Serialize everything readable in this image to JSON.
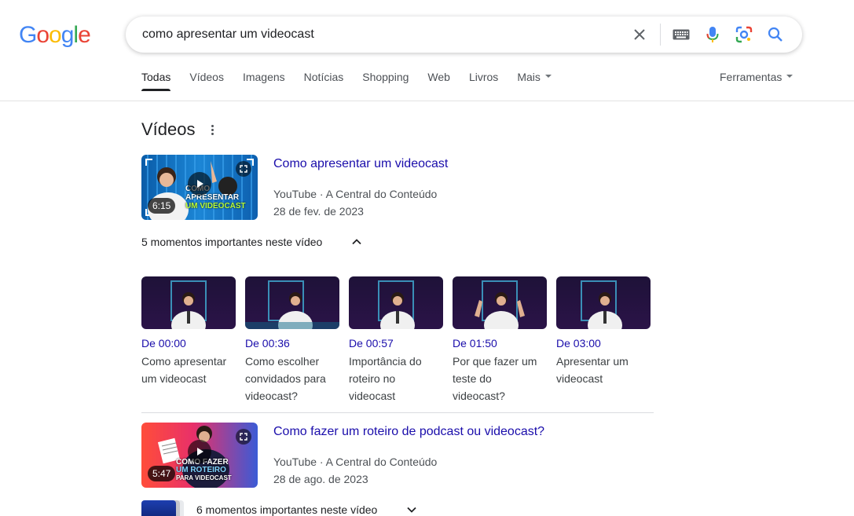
{
  "logo": {
    "letters": [
      "G",
      "o",
      "o",
      "g",
      "l",
      "e"
    ],
    "colors": [
      "#4285f4",
      "#ea4335",
      "#fbbc05",
      "#4285f4",
      "#34a853",
      "#ea4335"
    ]
  },
  "search": {
    "query": "como apresentar um videocast"
  },
  "tabs": [
    {
      "label": "Todas",
      "active": true
    },
    {
      "label": "Vídeos"
    },
    {
      "label": "Imagens"
    },
    {
      "label": "Notícias"
    },
    {
      "label": "Shopping"
    },
    {
      "label": "Web"
    },
    {
      "label": "Livros"
    },
    {
      "label": "Mais"
    }
  ],
  "tools_label": "Ferramentas",
  "section": {
    "title": "Vídeos"
  },
  "videos": [
    {
      "title": "Como apresentar um videocast",
      "source": "YouTube · A Central do Conteúdo",
      "date": "28 de fev. de 2023",
      "duration": "6:15",
      "thumb_text": [
        "COMO",
        "APRESENTAR",
        "UM VIDEOCAST"
      ],
      "moments_label": "5 momentos importantes neste vídeo",
      "moments": [
        {
          "time": "De 00:00",
          "label": "Como apresentar um videocast"
        },
        {
          "time": "De 00:36",
          "label": "Como escolher convidados para videocast?"
        },
        {
          "time": "De 00:57",
          "label": "Importância do roteiro no videocast"
        },
        {
          "time": "De 01:50",
          "label": "Por que fazer um teste do videocast?"
        },
        {
          "time": "De 03:00",
          "label": "Apresentar um videocast"
        }
      ]
    },
    {
      "title": "Como fazer um roteiro de podcast ou videocast?",
      "source": "YouTube · A Central do Conteúdo",
      "date": "28 de ago. de 2023",
      "duration": "5:47",
      "thumb_text": [
        "COMO FAZER",
        "UM ROTEIRO",
        "PARA VIDEOCAST"
      ],
      "moments_label": "6 momentos importantes neste vídeo"
    }
  ]
}
